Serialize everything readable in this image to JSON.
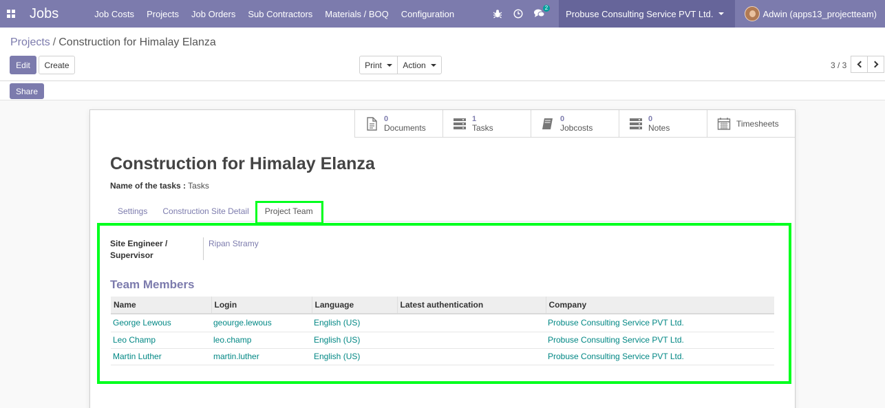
{
  "navbar": {
    "app_name": "Jobs",
    "menu": [
      "Job Costs",
      "Projects",
      "Job Orders",
      "Sub Contractors",
      "Materials / BOQ",
      "Configuration"
    ],
    "chat_badge": "2",
    "company": "Probuse Consulting Service PVT Ltd.",
    "user": "Adwin (apps13_projectteam)",
    "icons": [
      "apps-grid-icon",
      "bug-icon",
      "clock-icon",
      "chat-icon"
    ]
  },
  "breadcrumb": {
    "parent": "Projects",
    "separator": "/",
    "current": "Construction for Himalay Elanza"
  },
  "toolbar": {
    "edit": "Edit",
    "create": "Create",
    "print": "Print",
    "action": "Action",
    "share": "Share"
  },
  "pager": {
    "value": "3 / 3"
  },
  "stats": [
    {
      "value": "0",
      "label": "Documents",
      "icon": "document-icon"
    },
    {
      "value": "1",
      "label": "Tasks",
      "icon": "tasks-icon"
    },
    {
      "value": "0",
      "label": "Jobcosts",
      "icon": "book-icon"
    },
    {
      "value": "0",
      "label": "Notes",
      "icon": "notes-icon"
    },
    {
      "value": "",
      "label": "Timesheets",
      "icon": "calendar-icon"
    }
  ],
  "record": {
    "title": "Construction for Himalay Elanza",
    "task_name_label": "Name of the tasks :",
    "task_name_value": "Tasks"
  },
  "tabs": [
    "Settings",
    "Construction Site Detail",
    "Project Team"
  ],
  "active_tab": "Project Team",
  "site_engineer": {
    "label": "Site Engineer / Supervisor",
    "value": "Ripan Stramy"
  },
  "team": {
    "title": "Team Members",
    "columns": [
      "Name",
      "Login",
      "Language",
      "Latest authentication",
      "Company"
    ],
    "rows": [
      [
        "George Lewous",
        "geourge.lewous",
        "English (US)",
        "",
        "Probuse Consulting Service PVT Ltd."
      ],
      [
        "Leo Champ",
        "leo.champ",
        "English (US)",
        "",
        "Probuse Consulting Service PVT Ltd."
      ],
      [
        "Martin Luther",
        "martin.luther",
        "English (US)",
        "",
        "Probuse Consulting Service PVT Ltd."
      ]
    ]
  },
  "colors": {
    "brand": "#7c7bad",
    "link": "#008784",
    "highlight": "#00ff1e"
  }
}
